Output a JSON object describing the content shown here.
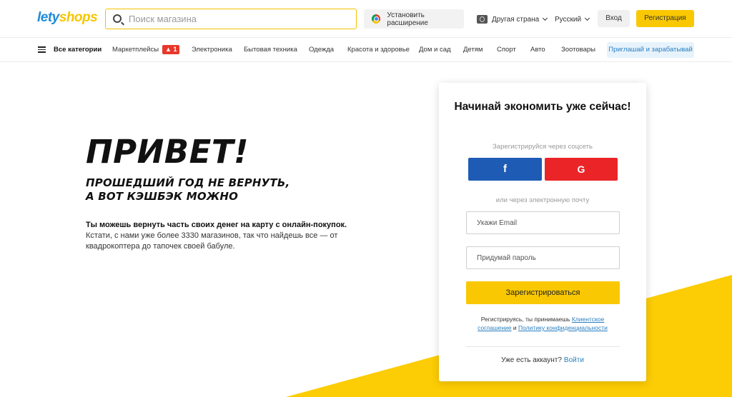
{
  "header": {
    "logo": {
      "part1": "lety",
      "part2": "shops"
    },
    "search": {
      "placeholder": "Поиск магазина",
      "value": ""
    },
    "extension_label": "Установить расширение",
    "country_label": "Другая страна",
    "language_label": "Русский",
    "login_label": "Вход",
    "register_label": "Регистрация"
  },
  "nav": {
    "all_categories": "Все категории",
    "marketplaces": {
      "label": "Маркетплейсы",
      "badge": "1"
    },
    "items": [
      "Электроника",
      "Бытовая техника",
      "Одежда",
      "Красота и здоровье",
      "Дом и сад",
      "Детям",
      "Спорт",
      "Авто",
      "Зоотовары"
    ],
    "invite_label": "Приглашай и зарабатывай"
  },
  "hero": {
    "title": "ПРИВЕТ!",
    "subtitle_line1": "ПРОШЕДШИЙ ГОД НЕ ВЕРНУТЬ,",
    "subtitle_line2": "А ВОТ КЭШБЭК МОЖНО",
    "text_bold": "Ты можешь вернуть часть своих денег на карту с онлайн-покупок.",
    "text_rest": "Кстати, с нами уже более 3330 магазинов, так что найдешь все — от квадрокоптера до тапочек своей бабуле."
  },
  "signup": {
    "title": "Начинай экономить уже сейчас!",
    "social_label": "Зарегистрируйся через соцсеть",
    "facebook_letter": "f",
    "google_letter": "G",
    "email_label": "или через электронную почту",
    "email_placeholder": "Укажи Email",
    "password_placeholder": "Придумай пароль",
    "submit_label": "Зарегистрироваться",
    "terms_prefix": "Регистрируясь, ты принимаешь",
    "terms_link": "Клиентское соглашение",
    "terms_and": "и",
    "privacy_link": "Политику конфиденциальности",
    "have_account": "Уже есть аккаунт?",
    "login_link": "Войти"
  },
  "colors": {
    "accent_yellow": "#f9c802",
    "brand_blue": "#1d8bd9",
    "facebook": "#1e5bb4",
    "google": "#ea2427"
  }
}
